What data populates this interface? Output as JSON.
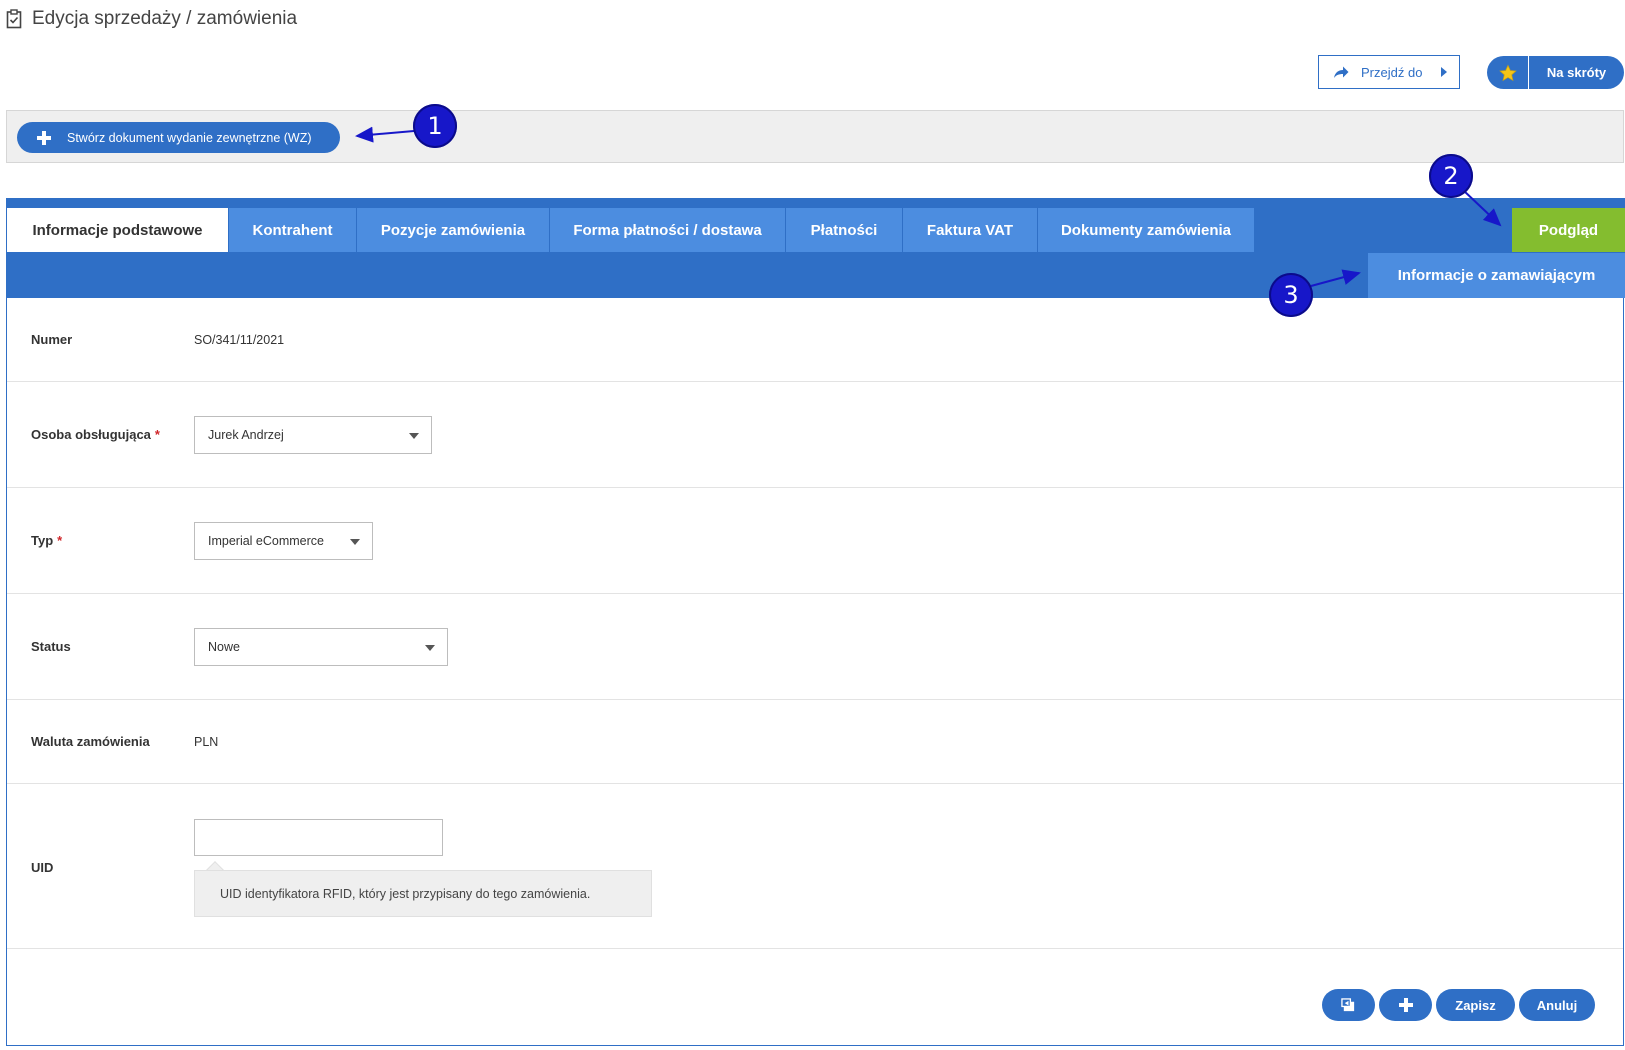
{
  "header": {
    "title": "Edycja sprzedaży / zamówienia",
    "goto_label": "Przejdź do",
    "shortcuts_label": "Na skróty"
  },
  "action_bar": {
    "create_wz_label": "Stwórz dokument wydanie zewnętrzne (WZ)"
  },
  "tabs": [
    {
      "label": "Informacje podstawowe",
      "active": true
    },
    {
      "label": "Kontrahent",
      "active": false
    },
    {
      "label": "Pozycje zamówienia",
      "active": false
    },
    {
      "label": "Forma płatności / dostawa",
      "active": false
    },
    {
      "label": "Płatności",
      "active": false
    },
    {
      "label": "Faktura VAT",
      "active": false
    },
    {
      "label": "Dokumenty zamówienia",
      "active": false
    }
  ],
  "preview_label": "Podgląd",
  "subtab_label": "Informacje o zamawiającym",
  "form": {
    "numer": {
      "label": "Numer",
      "value": "SO/341/11/2021"
    },
    "osoba": {
      "label": "Osoba obsługująca",
      "required_mark": "*",
      "value": "Jurek Andrzej"
    },
    "typ": {
      "label": "Typ",
      "required_mark": "*",
      "value": "Imperial eCommerce"
    },
    "status": {
      "label": "Status",
      "value": "Nowe"
    },
    "waluta": {
      "label": "Waluta zamówienia",
      "value": "PLN"
    },
    "uid": {
      "label": "UID",
      "value": "",
      "hint": "UID identyfikatora RFID, który jest przypisany do tego zamówienia."
    }
  },
  "footer_buttons": {
    "save_label": "Zapisz",
    "cancel_label": "Anuluj"
  },
  "callouts": [
    "1",
    "2",
    "3"
  ],
  "colors": {
    "primary": "#2f6fc6",
    "tab": "#4c8de0",
    "preview": "#84bd2f",
    "callout": "#1717c9",
    "required": "#d0262a"
  }
}
